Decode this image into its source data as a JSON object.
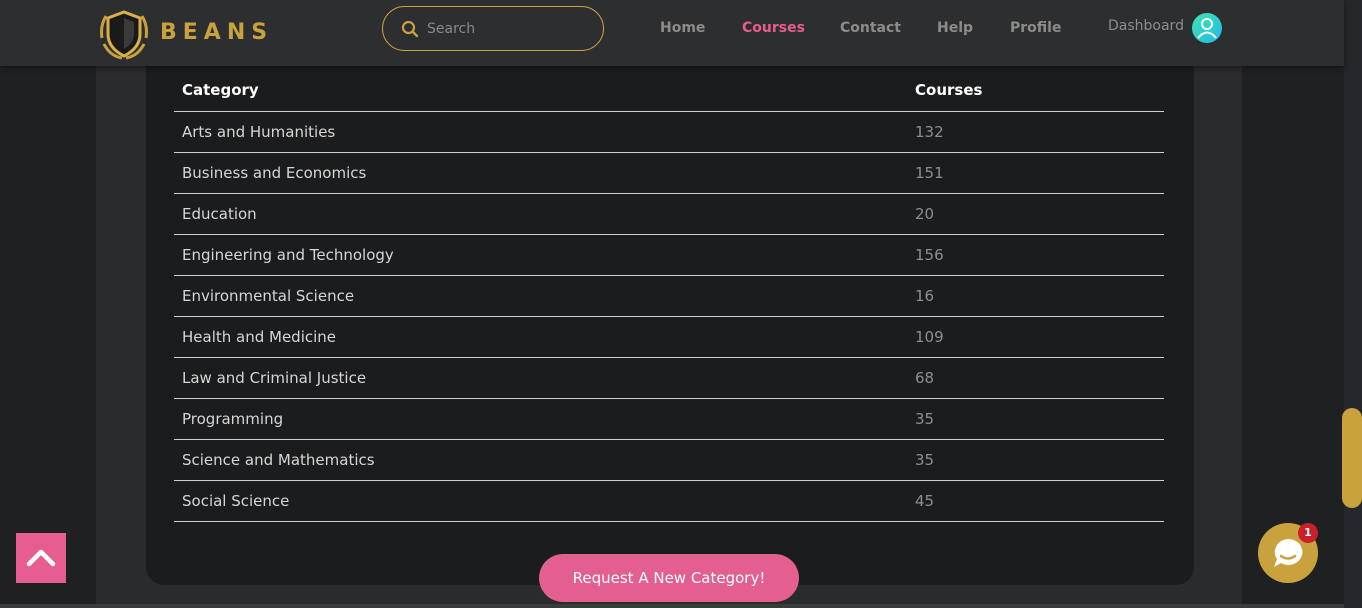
{
  "brand": {
    "name": "BEANS",
    "accent": "#c9a23e"
  },
  "search": {
    "placeholder": "Search"
  },
  "nav": {
    "items": [
      {
        "label": "Home",
        "active": false
      },
      {
        "label": "Courses",
        "active": true
      },
      {
        "label": "Contact",
        "active": false
      },
      {
        "label": "Help",
        "active": false
      },
      {
        "label": "Profile",
        "active": false
      }
    ],
    "dashboard_label": "Dashboard",
    "active_color": "#e85d8f"
  },
  "table": {
    "headers": {
      "category": "Category",
      "courses": "Courses"
    },
    "rows": [
      {
        "category": "Arts and Humanities",
        "courses": "132"
      },
      {
        "category": "Business and Economics",
        "courses": "151"
      },
      {
        "category": "Education",
        "courses": "20"
      },
      {
        "category": "Engineering and Technology",
        "courses": "156"
      },
      {
        "category": "Environmental Science",
        "courses": "16"
      },
      {
        "category": "Health and Medicine",
        "courses": "109"
      },
      {
        "category": "Law and Criminal Justice",
        "courses": "68"
      },
      {
        "category": "Programming",
        "courses": "35"
      },
      {
        "category": "Science and Mathematics",
        "courses": "35"
      },
      {
        "category": "Social Science",
        "courses": "45"
      }
    ]
  },
  "request_button": {
    "label": "Request A New Category!"
  },
  "chat": {
    "badge_count": "1"
  },
  "icons": [
    "shield-logo-icon",
    "search-icon",
    "user-avatar-icon",
    "chevron-up-icon",
    "chat-icon"
  ]
}
